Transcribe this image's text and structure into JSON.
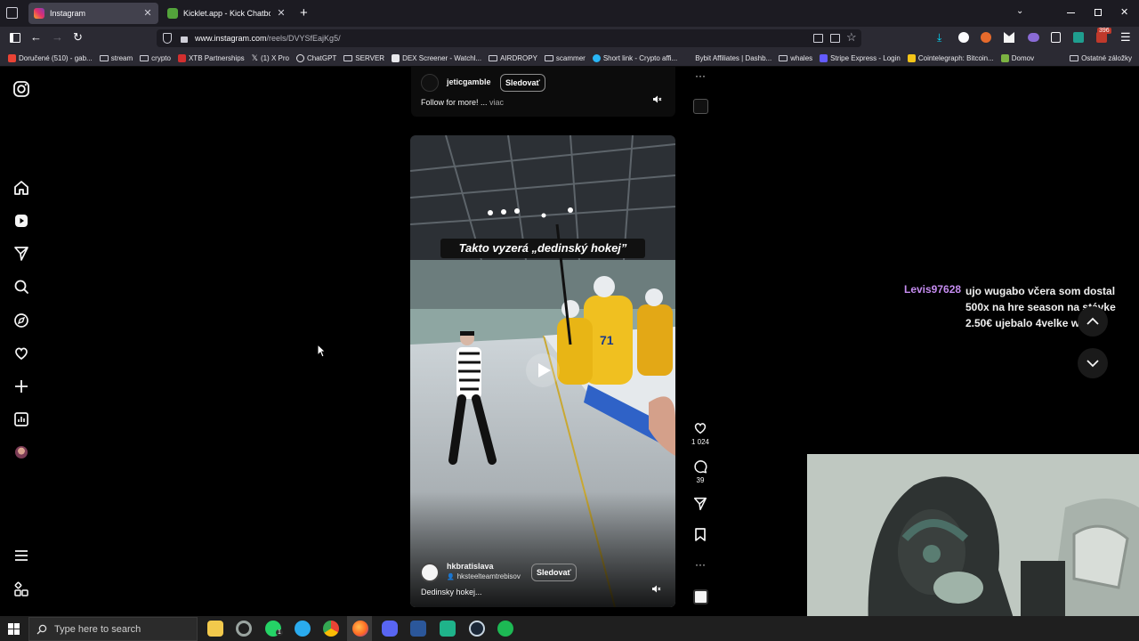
{
  "browser": {
    "tabs": [
      {
        "title": "Instagram",
        "active": true
      },
      {
        "title": "Kicklet.app - Kick Chatbot and C",
        "active": false
      }
    ],
    "url": {
      "domain": "www.instagram.com",
      "path": "/reels/DVYSfEajKg5/"
    },
    "bookmarks": [
      "Doručené (510) - gab...",
      "stream",
      "crypto",
      "XTB Partnerships",
      "(1) X Pro",
      "ChatGPT",
      "SERVER",
      "DEX Screener - Watchl...",
      "AIRDROPY",
      "scammer",
      "Short link - Crypto affi...",
      "Bybit Affiliates | Dashb...",
      "whales",
      "Stripe Express - Login",
      "Cointelegraph: Bitcoin...",
      "Domov"
    ],
    "other_bookmarks": "Ostatné záložky",
    "extension_badge": "396"
  },
  "reel_top": {
    "username": "jeticgamble",
    "follow_label": "Sledovať",
    "caption": "Follow for more! ...",
    "more_label": "viac"
  },
  "reel": {
    "overlay_text": "Takto vyzerá „dedinský hokej”",
    "jersey_number": "71",
    "username": "hkbratislava",
    "collab": "hksteelteamtrebisov",
    "follow_label": "Sledovať",
    "caption": "Dedinsky hokej..."
  },
  "actions": {
    "likes": "1 024",
    "comments": "39"
  },
  "chat": {
    "user": "Levis97628",
    "message": "ujo wugabo včera som dostal 500x na hre season na stávke 2.50€ ujebalo 4velke wildy"
  },
  "taskbar": {
    "search_placeholder": "Type here to search",
    "badge": "1"
  },
  "colors": {
    "accent": "#c58cf0",
    "browser_bg": "#2b2a33",
    "page_bg": "#000000"
  }
}
